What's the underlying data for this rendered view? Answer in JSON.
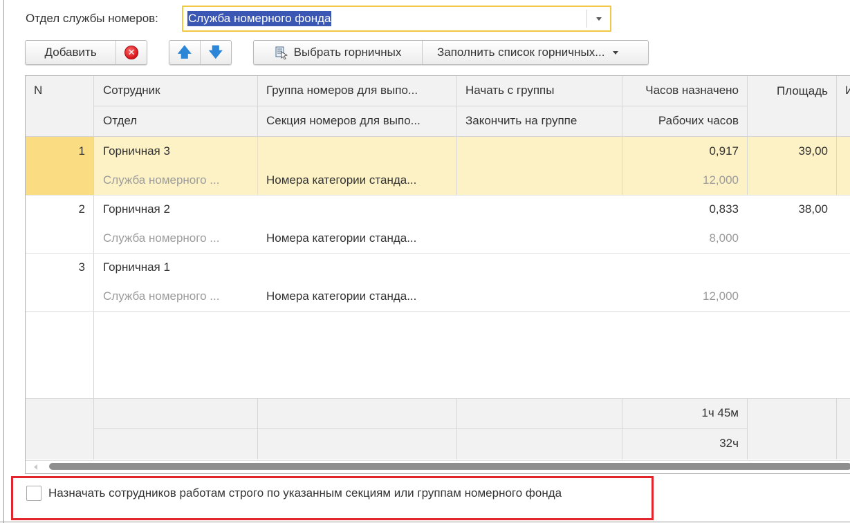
{
  "department": {
    "label": "Отдел службы номеров:",
    "value": "Служба номерного фонда"
  },
  "toolbar": {
    "add_label": "Добавить",
    "select_maids_label": "Выбрать горничных",
    "fill_list_label": "Заполнить список горничных..."
  },
  "table": {
    "headers_top": [
      "N",
      "Сотрудник",
      "Группа номеров для выпо...",
      "Начать с группы",
      "Часов назначено",
      "Площадь",
      "И"
    ],
    "headers_bottom": [
      "Отдел",
      "Секция номеров для выпо...",
      "Закончить на группе",
      "Рабочих часов"
    ],
    "rows": [
      {
        "n": "1",
        "employee": "Горничная 3",
        "department": "Служба номерного ...",
        "group": "",
        "section": "Номера категории станда...",
        "start_group": "",
        "end_group": "",
        "hours_assigned": "0,917",
        "work_hours": "12,000",
        "area": "39,00",
        "selected": true
      },
      {
        "n": "2",
        "employee": "Горничная 2",
        "department": "Служба номерного ...",
        "group": "",
        "section": "Номера категории станда...",
        "start_group": "",
        "end_group": "",
        "hours_assigned": "0,833",
        "work_hours": "8,000",
        "area": "38,00",
        "selected": false
      },
      {
        "n": "3",
        "employee": "Горничная 1",
        "department": "Служба номерного ...",
        "group": "",
        "section": "Номера категории станда...",
        "start_group": "",
        "end_group": "",
        "hours_assigned": "",
        "work_hours": "12,000",
        "area": "",
        "selected": false
      }
    ],
    "footer": {
      "hours_assigned_total": "1ч 45м",
      "work_hours_total": "32ч"
    }
  },
  "option": {
    "checked": false,
    "label": "Назначать сотрудников работам строго по указанным секциям или группам номерного фонда"
  },
  "colors": {
    "selection_row": "#fdf2c6",
    "selection_num": "#fadc82",
    "highlight_border": "#e2242c",
    "input_focus": "#f2c744",
    "text_selection": "#3a57b4"
  }
}
